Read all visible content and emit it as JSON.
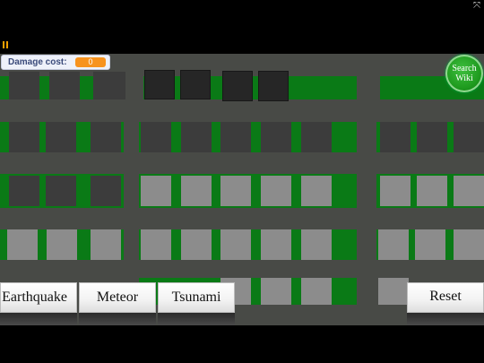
{
  "hud": {
    "damage_label": "Damage cost:",
    "damage_value": "0",
    "search_wiki": "Search Wiki"
  },
  "icons": {
    "fullscreen": "expand-arrows-icon",
    "pause": "pause-icon"
  },
  "buttons": {
    "earthquake": "Earthquake",
    "meteor": "Meteor",
    "tsunami": "Tsunami",
    "reset": "Reset"
  },
  "colors": {
    "road": "#484a46",
    "grass": "#0a7a16",
    "building_dark": "#3c3c3c",
    "building_light": "#8c8c8c",
    "damage_value_bg": "#f7931e",
    "wiki_button": "#1e9a1e"
  }
}
